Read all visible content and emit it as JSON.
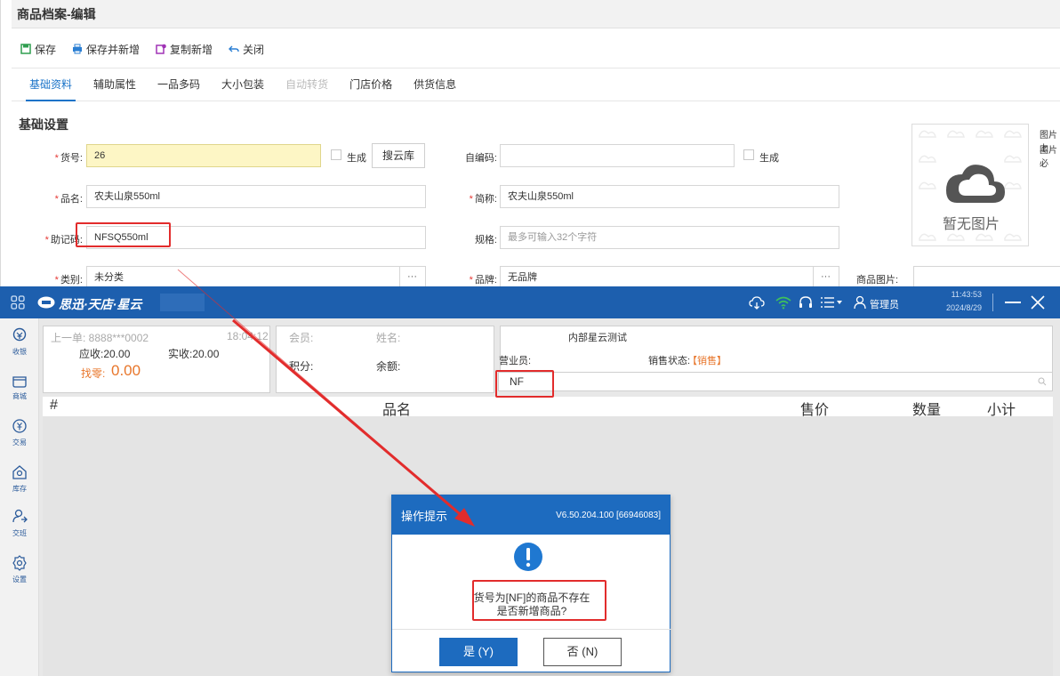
{
  "top": {
    "title": "商品档案-编辑",
    "toolbar": {
      "save": "保存",
      "save_new": "保存并新增",
      "copy_new": "复制新增",
      "close": "关闭"
    },
    "tabs": [
      {
        "label": "基础资料",
        "state": "active"
      },
      {
        "label": "辅助属性",
        "state": "normal"
      },
      {
        "label": "一品多码",
        "state": "normal"
      },
      {
        "label": "大小包装",
        "state": "normal"
      },
      {
        "label": "自动转货",
        "state": "disabled"
      },
      {
        "label": "门店价格",
        "state": "normal"
      },
      {
        "label": "供货信息",
        "state": "normal"
      }
    ],
    "section_title": "基础设置",
    "fields": {
      "item_no": {
        "label": "货号:",
        "value": "26"
      },
      "generate1": "生成",
      "search_cloud": "搜云库",
      "self_code": {
        "label": "自编码:",
        "value": ""
      },
      "generate2": "生成",
      "name": {
        "label": "品名:",
        "value": "农夫山泉550ml"
      },
      "short_name": {
        "label": "简称:",
        "value": "农夫山泉550ml"
      },
      "mnemonic": {
        "label": "助记码:",
        "value": "NFSQ550ml"
      },
      "spec": {
        "label": "规格:",
        "placeholder": "最多可输入32个字符"
      },
      "category": {
        "label": "类别:",
        "value": "未分类"
      },
      "brand": {
        "label": "品牌:",
        "value": "无品牌"
      },
      "dots1": "···",
      "dots2": "···",
      "product_image": "商品图片:"
    },
    "image": {
      "empty_text": "暂无图片",
      "note1": "图片上",
      "note2": "图片必"
    }
  },
  "pos": {
    "brand": "思迅·天店·星云",
    "time": "11:43:53",
    "date": "2024/8/29",
    "admin": "管理员",
    "sidebar": [
      {
        "label": "收银",
        "icon": "cashier-icon"
      },
      {
        "label": "商城",
        "icon": "mall-icon"
      },
      {
        "label": "交易",
        "icon": "trade-icon"
      },
      {
        "label": "库存",
        "icon": "stock-icon"
      },
      {
        "label": "交班",
        "icon": "shift-icon"
      },
      {
        "label": "设置",
        "icon": "settings-icon"
      }
    ],
    "last_order": {
      "label": "上一单: 8888***0002",
      "time": "18:04:12",
      "receivable": "应收:20.00",
      "received": "实收:20.00",
      "change_label": "找零:",
      "change_value": "0.00"
    },
    "member": {
      "member": "会员:",
      "name": "姓名:",
      "points": "积分:",
      "balance": "余额:"
    },
    "store": {
      "name": "内部星云测试",
      "salesperson": "营业员:",
      "sale_status_label": "销售状态:",
      "sale_status_value": "【销售】"
    },
    "search_value": "NF",
    "grid_headers": {
      "index": "#",
      "name": "品名",
      "price": "售价",
      "qty": "数量",
      "subtotal": "小计"
    }
  },
  "dialog": {
    "title": "操作提示",
    "version": "V6.50.204.100 [66946083]",
    "message_line1": "货号为[NF]的商品不存在",
    "message_line2": "是否新增商品?",
    "yes": "是 (Y)",
    "no": "否 (N)"
  },
  "colors": {
    "pos_header": "#1d5fae",
    "accent": "#1a73c8",
    "highlight_input": "#fdf6c5",
    "annotation": "#e22c2c",
    "orange": "#e8762b"
  }
}
